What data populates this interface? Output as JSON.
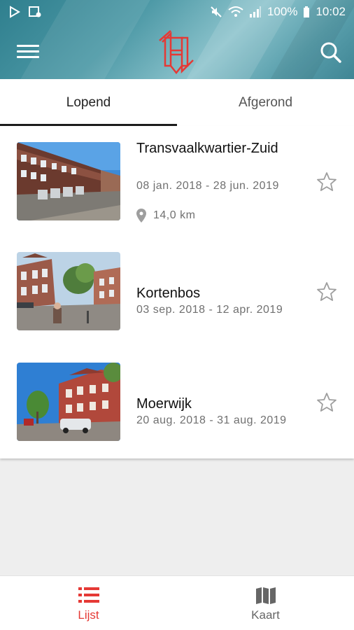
{
  "status_bar": {
    "battery": "100%",
    "time": "10:02"
  },
  "header": {
    "menu_icon": "hamburger-menu-icon",
    "logo_icon": "h-arrows-logo",
    "search_icon": "search-icon"
  },
  "tabs": [
    {
      "label": "Lopend",
      "active": true
    },
    {
      "label": "Afgerond",
      "active": false
    }
  ],
  "items": [
    {
      "title": "Transvaalkwartier-Zuid",
      "dates": "08 jan. 2018 - 28 jun. 2019",
      "distance": "14,0 km",
      "starred": false
    },
    {
      "title": "Kortenbos",
      "dates": "03 sep. 2018 - 12 apr. 2019",
      "starred": false
    },
    {
      "title": "Moerwijk",
      "dates": "20 aug. 2018 - 31 aug. 2019",
      "starred": false
    }
  ],
  "bottom_nav": [
    {
      "label": "Lijst",
      "icon": "list-icon",
      "active": true
    },
    {
      "label": "Kaart",
      "icon": "map-icon",
      "active": false
    }
  ],
  "colors": {
    "accent": "#e53935",
    "header_teal": "#4d99a6",
    "secondary_text": "#707070",
    "inactive_nav": "#666666"
  }
}
